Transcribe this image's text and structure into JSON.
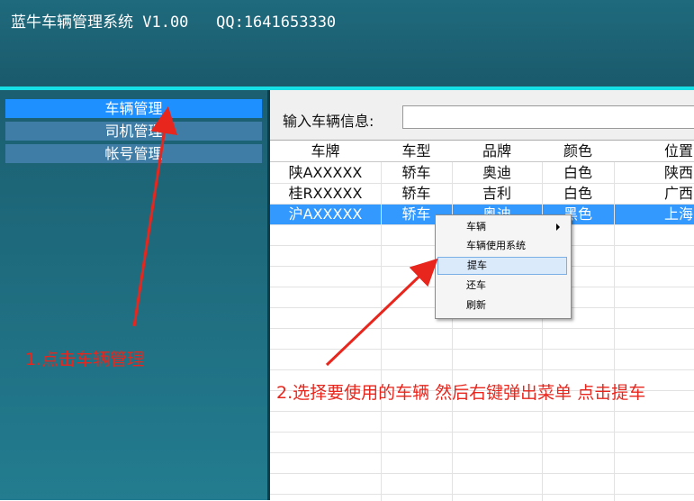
{
  "window": {
    "title": "蓝牛车辆管理系统 V1.00   QQ:1641653330"
  },
  "sidebar": {
    "items": [
      {
        "label": "车辆管理",
        "active": true
      },
      {
        "label": "司机管理",
        "active": false
      },
      {
        "label": "帐号管理",
        "active": false
      }
    ]
  },
  "search": {
    "label": "输入车辆信息:",
    "value": ""
  },
  "table": {
    "columns": [
      "车牌",
      "车型",
      "品牌",
      "颜色",
      "位置"
    ],
    "rows": [
      [
        "陕AXXXXX",
        "轿车",
        "奥迪",
        "白色",
        "陕西"
      ],
      [
        "桂RXXXXX",
        "轿车",
        "吉利",
        "白色",
        "广西"
      ],
      [
        "沪AXXXXX",
        "轿车",
        "奥迪",
        "黑色",
        "上海"
      ]
    ],
    "selected_row": 2
  },
  "context_menu": {
    "items": [
      "车辆",
      "车辆使用系统",
      "提车",
      "还车",
      "刷新"
    ],
    "highlighted": 2
  },
  "annotations": {
    "step1": "1.点击车辆管理",
    "step2": "2.选择要使用的车辆 然后右键弹出菜单 点击提车"
  },
  "colors": {
    "header": "#1f6a7d",
    "accent": "#17dfe6",
    "selection": "#3399ff",
    "annotation": "#e8261d"
  }
}
